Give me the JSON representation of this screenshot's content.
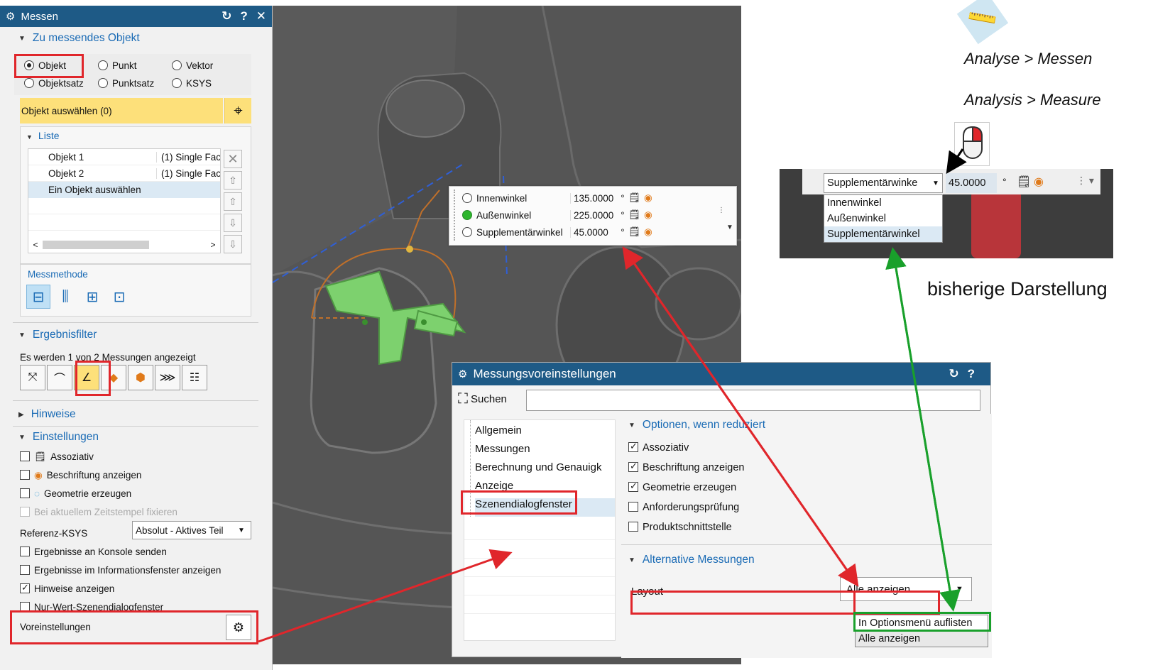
{
  "measure_dialog": {
    "title": "Messen",
    "section_object": "Zu messendes Objekt",
    "radio_objekt": "Objekt",
    "radio_punkt": "Punkt",
    "radio_vektor": "Vektor",
    "radio_objektsatz": "Objektsatz",
    "radio_punktsatz": "Punktsatz",
    "radio_ksys": "KSYS",
    "select_object": "Objekt auswählen (0)",
    "list_header": "Liste",
    "list_rows": [
      {
        "name": "Objekt 1",
        "type": "(1) Single Fac"
      },
      {
        "name": "Objekt 2",
        "type": "(1) Single Fac"
      },
      {
        "name": "Ein Objekt auswählen",
        "type": ""
      }
    ],
    "method_label": "Messmethode",
    "section_filter": "Ergebnisfilter",
    "filter_info": "Es werden 1 von 2 Messungen angezeigt",
    "section_hints": "Hinweise",
    "section_settings": "Einstellungen",
    "cb_assoziativ": "Assoziativ",
    "cb_beschriftung": "Beschriftung anzeigen",
    "cb_geometrie": "Geometrie erzeugen",
    "cb_zeitstempel": "Bei aktuellem Zeitstempel fixieren",
    "ref_ksys_label": "Referenz-KSYS",
    "ref_ksys_value": "Absolut - Aktives Teil",
    "cb_konsole": "Ergebnisse an Konsole senden",
    "cb_infofenster": "Ergebnisse im Informationsfenster anzeigen",
    "cb_hinweise": "Hinweise anzeigen",
    "cb_nurwert": "Nur-Wert-Szenendialogfenster",
    "voreinstellungen": "Voreinstellungen"
  },
  "angle_popup": {
    "rows": [
      {
        "label": "Innenwinkel",
        "value": "135.0000",
        "unit": "°"
      },
      {
        "label": "Außenwinkel",
        "value": "225.0000",
        "unit": "°"
      },
      {
        "label": "Supplementärwinkel",
        "value": "45.0000",
        "unit": "°"
      }
    ]
  },
  "settings_dialog": {
    "title": "Messungsvoreinstellungen",
    "search_label": "Suchen",
    "tree": [
      "Allgemein",
      "Messungen",
      "Berechnung und Genauigk",
      "Anzeige",
      "Szenendialogfenster"
    ],
    "section_options": "Optionen, wenn reduziert",
    "opt_assoziativ": "Assoziativ",
    "opt_beschriftung": "Beschriftung anzeigen",
    "opt_geometrie": "Geometrie erzeugen",
    "opt_anforderung": "Anforderungsprüfung",
    "opt_produkt": "Produktschnittstelle",
    "section_alt": "Alternative Messungen",
    "layout_label": "Layout",
    "layout_value": "Alle anzeigen",
    "layout_options": [
      "In Optionsmenü auflisten",
      "Alle anzeigen"
    ]
  },
  "annotations": {
    "menu_de": "Analyse > Messen",
    "menu_en": "Analysis > Measure",
    "old_caption": "bisherige Darstellung",
    "old_dropdown_value": "Supplementärwinke",
    "old_value": "45.0000",
    "old_unit": "°",
    "old_options": [
      "Innenwinkel",
      "Außenwinkel",
      "Supplementärwinkel"
    ]
  },
  "colors": {
    "titlebar": "#1e5a86",
    "highlight_red": "#e0262b",
    "highlight_green": "#19a02b",
    "selection_yellow": "#fde07a",
    "section_blue": "#1a6bb5"
  }
}
